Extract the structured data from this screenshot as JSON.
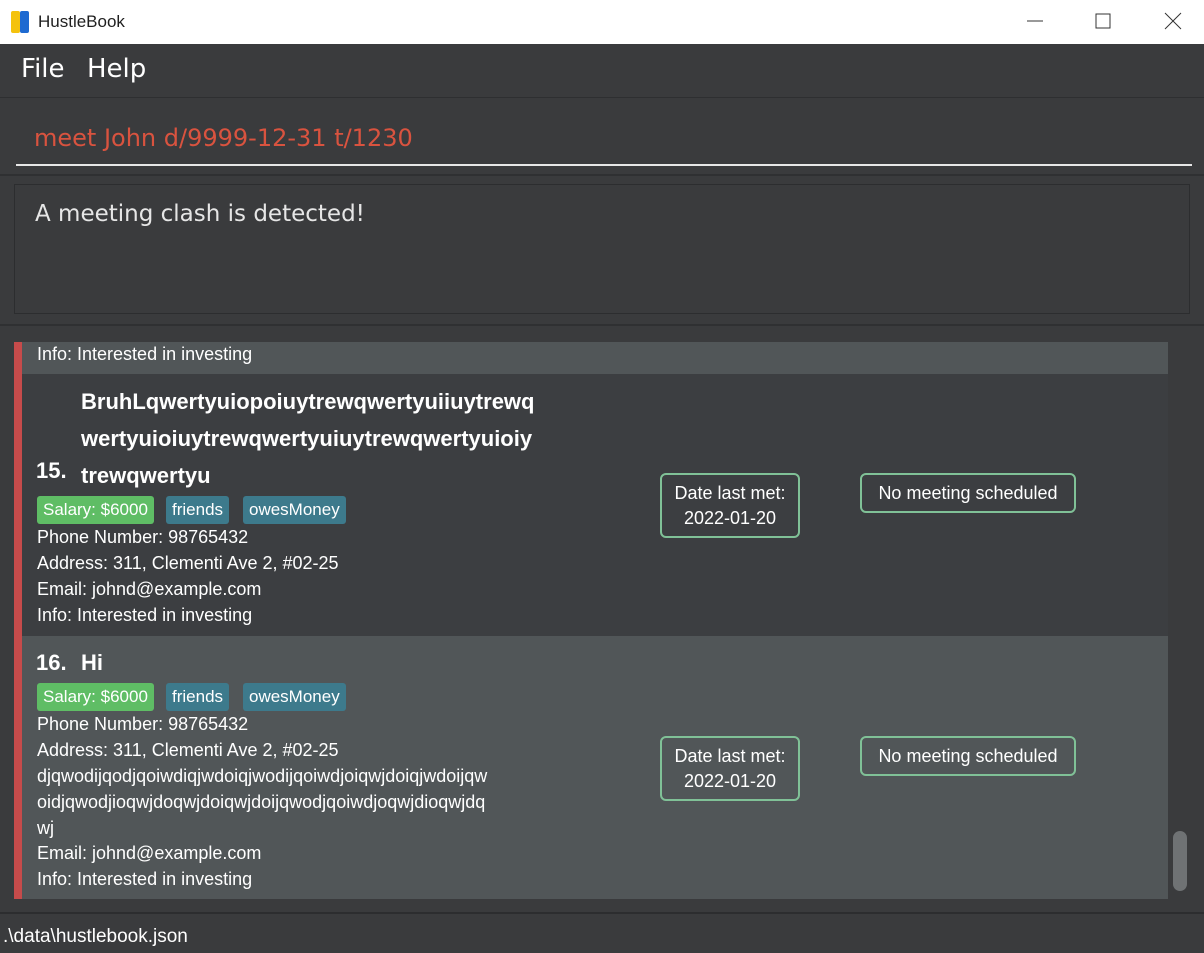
{
  "window": {
    "title": "HustleBook"
  },
  "menu": {
    "file_label": "File",
    "help_label": "Help"
  },
  "command": {
    "value": "meet John d/9999-12-31 t/1230"
  },
  "result": {
    "message": "A meeting clash is detected!"
  },
  "persons": [
    {
      "info": "Info: Interested in investing"
    },
    {
      "index": "15.",
      "name_lines": [
        "BruhLqwertyuiopoiuytrewqwertyuiiuytrewq",
        "wertyuioiuytrewqwertyuiuytrewqwertyuioiy",
        "trewqwertyu"
      ],
      "tags": [
        "Salary: $6000",
        "friends",
        "owesMoney"
      ],
      "phone": "Phone Number: 98765432",
      "address": "Address: 311, Clementi Ave 2, #02-25",
      "email": "Email: johnd@example.com",
      "info": "Info: Interested in investing",
      "date_last_met_label": "Date last met:",
      "date_last_met": "2022-01-20",
      "meeting": "No meeting scheduled"
    },
    {
      "index": "16.",
      "name": "Hi",
      "tags": [
        "Salary: $6000",
        "friends",
        "owesMoney"
      ],
      "phone": "Phone Number: 98765432",
      "address_lines": [
        "Address: 311, Clementi Ave 2, #02-25",
        "djqwodijqodjqoiwdiqjwdoiqjwodijqoiwdjoiqwjdoiqjwdoijqw",
        "oidjqwodjioqwjdoqwjdoiqwjdoijqwodjqoiwdjoqwjdioqwjdq",
        "wj"
      ],
      "email": "Email: johnd@example.com",
      "info": "Info: Interested in investing",
      "date_last_met_label": "Date last met:",
      "date_last_met": "2022-01-20",
      "meeting": "No meeting scheduled"
    }
  ],
  "status": {
    "file_path": ".\\data\\hustlebook.json"
  },
  "colors": {
    "command_text": "#d9533f",
    "card_accent": "#c64b4b",
    "salary_tag": "#5fbd65",
    "tag": "#3d7a8c",
    "pill_border": "#80c197"
  },
  "icons": [
    "app-logo-icon",
    "minimize-icon",
    "maximize-icon",
    "close-icon"
  ]
}
